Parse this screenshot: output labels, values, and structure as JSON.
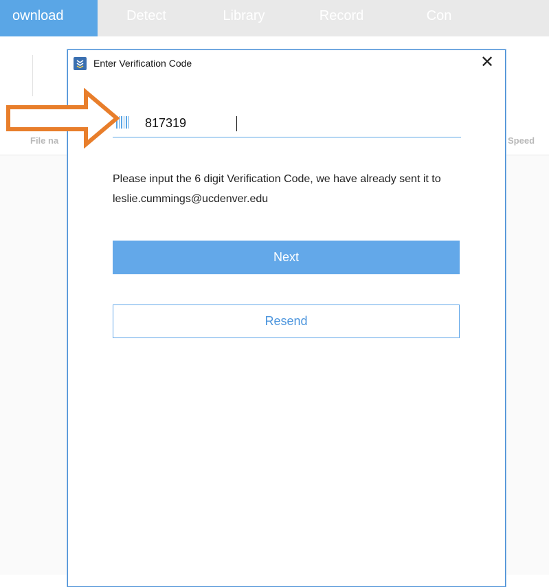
{
  "nav": {
    "tabs": [
      {
        "label": "ownload"
      },
      {
        "label": "Detect"
      },
      {
        "label": "Library"
      },
      {
        "label": "Record"
      },
      {
        "label": "Con"
      }
    ]
  },
  "columns": {
    "filename": "File na",
    "speed": "Speed"
  },
  "dialog": {
    "title": "Enter Verification Code",
    "close_symbol": "✕",
    "code_value": "817319",
    "message": "Please input the 6 digit Verification Code, we have already sent it to leslie.cummings@ucdenver.edu",
    "next_label": "Next",
    "resend_label": "Resend"
  },
  "colors": {
    "accent": "#63a8e9",
    "arrow": "#e87e2b"
  },
  "icons": {
    "app": "app-logo-icon",
    "code": "barcode-icon",
    "close": "close-icon",
    "annotation": "arrow-annotation"
  }
}
